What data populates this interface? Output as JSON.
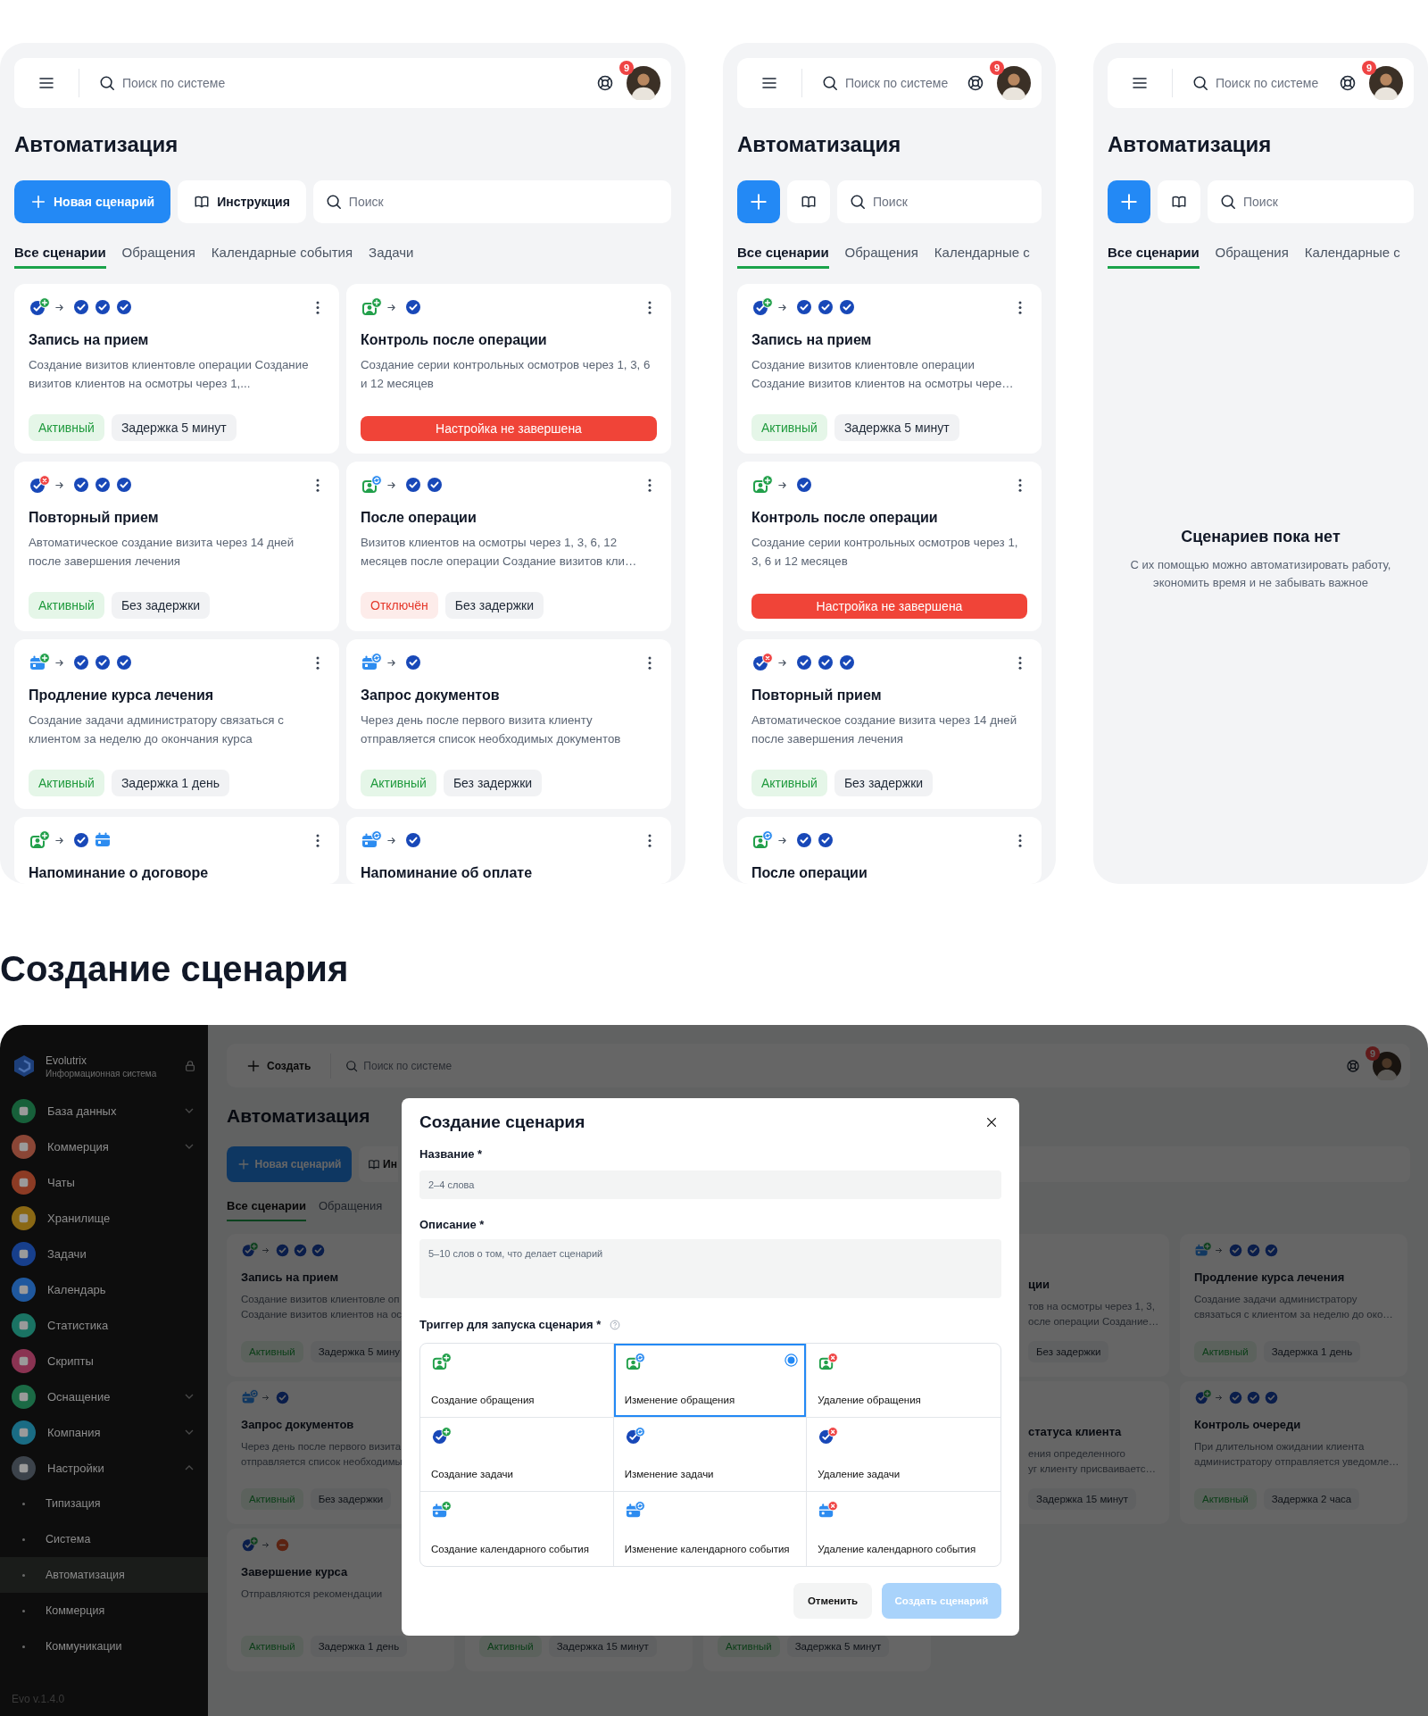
{
  "screens": [
    {
      "kind": "wide",
      "search_placeholder": "Поиск по системе",
      "notifications": "9",
      "title": "Автоматизация",
      "new_button": "Новая сценарий",
      "guide_button": "Инструкция",
      "filter_placeholder": "Поиск",
      "tabs": [
        {
          "label": "Все сценарии",
          "selected": true
        },
        {
          "label": "Обращения",
          "selected": false
        },
        {
          "label": "Календарные события",
          "selected": false
        },
        {
          "label": "Задачи",
          "selected": false
        }
      ],
      "cards": [
        {
          "trigger": {
            "kind": "task",
            "badge": {
              "kind": "add"
            }
          },
          "actions": [
            {
              "kind": "task"
            },
            {
              "kind": "task"
            },
            {
              "kind": "task"
            }
          ],
          "title": "Запись на прием",
          "description": "Создание визитов клиентовле операции Создание визитов клиентов на осмотры через 1,...",
          "status": {
            "label": "Активный",
            "kind": "active"
          },
          "delay": "Задержка 5 минут"
        },
        {
          "trigger": {
            "kind": "request",
            "badge": {
              "kind": "add"
            }
          },
          "actions": [
            {
              "kind": "task"
            }
          ],
          "title": "Контроль после операции",
          "description": "Создание серии контрольных осмотров через 1, 3, 6 и 12 месяцев",
          "alert": "Настройка не завершена"
        },
        {
          "trigger": {
            "kind": "task",
            "badge": {
              "kind": "remove"
            }
          },
          "actions": [
            {
              "kind": "task"
            },
            {
              "kind": "task"
            },
            {
              "kind": "task"
            }
          ],
          "title": "Повторный прием",
          "description": "Автоматическое создание визита через 14 дней после завершения лечения",
          "status": {
            "label": "Активный",
            "kind": "active"
          },
          "delay": "Без задержки"
        },
        {
          "trigger": {
            "kind": "request",
            "badge": {
              "kind": "edit"
            }
          },
          "actions": [
            {
              "kind": "task"
            },
            {
              "kind": "task"
            }
          ],
          "title": "После операции",
          "description": "Визитов клиентов на осмотры через 1, 3, 6, 12 месяцев после операции Создание визитов кли…",
          "status": {
            "label": "Отключён",
            "kind": "off"
          },
          "delay": "Без задержки"
        },
        {
          "trigger": {
            "kind": "event",
            "badge": {
              "kind": "add"
            }
          },
          "actions": [
            {
              "kind": "task"
            },
            {
              "kind": "task"
            },
            {
              "kind": "task"
            }
          ],
          "title": "Продление курса лечения",
          "description": "Создание задачи администратору связаться с клиентом за неделю до окончания курса",
          "status": {
            "label": "Активный",
            "kind": "active"
          },
          "delay": "Задержка 1 день"
        },
        {
          "trigger": {
            "kind": "event",
            "badge": {
              "kind": "edit"
            }
          },
          "actions": [
            {
              "kind": "task"
            }
          ],
          "title": "Запрос документов",
          "description": "Через день после первого визита клиенту отправляется список необходимых документов",
          "status": {
            "label": "Активный",
            "kind": "active"
          },
          "delay": "Без задержки"
        },
        {
          "trigger": {
            "kind": "request",
            "badge": {
              "kind": "add"
            }
          },
          "actions": [
            {
              "kind": "task"
            },
            {
              "kind": "event"
            }
          ],
          "title": "Напоминание о договоре"
        },
        {
          "trigger": {
            "kind": "event",
            "badge": {
              "kind": "edit"
            }
          },
          "actions": [
            {
              "kind": "task"
            }
          ],
          "title": "Напоминание об оплате"
        }
      ]
    },
    {
      "kind": "narrow",
      "search_placeholder": "Поиск по системе",
      "notifications": "9",
      "title": "Автоматизация",
      "filter_placeholder": "Поиск",
      "tabs": [
        {
          "label": "Все сценарии",
          "selected": true
        },
        {
          "label": "Обращения",
          "selected": false
        },
        {
          "label": "Календарные с",
          "selected": false
        }
      ],
      "cards": [
        {
          "trigger": {
            "kind": "task",
            "badge": {
              "kind": "add"
            }
          },
          "actions": [
            {
              "kind": "task"
            },
            {
              "kind": "task"
            },
            {
              "kind": "task"
            }
          ],
          "title": "Запись на прием",
          "description": "Создание визитов клиентовле операции Создание визитов клиентов на осмотры чере…",
          "status": {
            "label": "Активный",
            "kind": "active"
          },
          "delay": "Задержка 5 минут"
        },
        {
          "trigger": {
            "kind": "request",
            "badge": {
              "kind": "add"
            }
          },
          "actions": [
            {
              "kind": "task"
            }
          ],
          "title": "Контроль после операции",
          "description": "Создание серии контрольных осмотров через 1, 3, 6 и 12 месяцев",
          "alert": "Настройка не завершена"
        },
        {
          "trigger": {
            "kind": "task",
            "badge": {
              "kind": "remove"
            }
          },
          "actions": [
            {
              "kind": "task"
            },
            {
              "kind": "task"
            },
            {
              "kind": "task"
            }
          ],
          "title": "Повторный прием",
          "description": "Автоматическое создание визита через 14 дней после завершения лечения",
          "status": {
            "label": "Активный",
            "kind": "active"
          },
          "delay": "Без задержки"
        },
        {
          "trigger": {
            "kind": "request",
            "badge": {
              "kind": "edit"
            }
          },
          "actions": [
            {
              "kind": "task"
            },
            {
              "kind": "task"
            }
          ],
          "title": "После операции"
        }
      ]
    },
    {
      "kind": "empty",
      "search_placeholder": "Поиск по системе",
      "notifications": "9",
      "title": "Автоматизация",
      "filter_placeholder": "Поиск",
      "tabs": [
        {
          "label": "Все сценарии",
          "selected": true
        },
        {
          "label": "Обращения",
          "selected": false
        },
        {
          "label": "Календарные с",
          "selected": false
        }
      ],
      "empty_title": "Сценариев пока нет",
      "empty_text": "С их помощью можно автоматизировать работу, экономить время и не забывать важное"
    }
  ],
  "section_title": "Создание сценария",
  "app": {
    "brand": "Evolutrix",
    "subtitle": "Информационная система",
    "version": "Evo v.1.4.0",
    "nav": [
      {
        "label": "База данных",
        "color": "#17603a",
        "expanded": false
      },
      {
        "label": "Коммерция",
        "color": "#8a4636",
        "expanded": false
      },
      {
        "label": "Чаты",
        "color": "#8c3b24"
      },
      {
        "label": "Хранилище",
        "color": "#8a6814"
      },
      {
        "label": "Задачи",
        "color": "#173f8c"
      },
      {
        "label": "Календарь",
        "color": "#1f589e"
      },
      {
        "label": "Статистика",
        "color": "#1a7363"
      },
      {
        "label": "Скрипты",
        "color": "#8a3352"
      },
      {
        "label": "Оснащение",
        "color": "#1b6a45",
        "expanded": false
      },
      {
        "label": "Компания",
        "color": "#1a6c84",
        "expanded": false
      },
      {
        "label": "Настройки",
        "color": "#3c434b",
        "expanded": true,
        "children": [
          {
            "label": "Типизация",
            "selected": false
          },
          {
            "label": "Система",
            "selected": false
          },
          {
            "label": "Автоматизация",
            "selected": true
          },
          {
            "label": "Коммерция",
            "selected": false
          },
          {
            "label": "Коммуникации",
            "selected": false
          }
        ]
      }
    ],
    "create_button": "Создать",
    "search_placeholder": "Поиск по системе",
    "notifications": "9",
    "title": "Автоматизация",
    "new_button": "Новая сценарий",
    "guide_button": "Ин",
    "tabs": [
      {
        "label": "Все сценарии",
        "selected": true
      },
      {
        "label": "Обращения",
        "selected": false
      }
    ],
    "cards": [
      {
        "kind": "full",
        "trigger": {
          "kind": "task",
          "badge": {
            "kind": "add"
          }
        },
        "actions": [
          {
            "kind": "task"
          },
          {
            "kind": "task"
          },
          {
            "kind": "task"
          }
        ],
        "title": "Запись на прием",
        "description_lines": [
          "Создание визитов клиентовле оп",
          "Создание визитов клиентов на ос"
        ],
        "status": {
          "label": "Активный",
          "kind": "active"
        },
        "delay": "Задержка 5 мину"
      },
      {
        "kind": "covered"
      },
      {
        "kind": "covered"
      },
      {
        "kind": "fragment",
        "title": "ции",
        "description_lines": [
          "тов на осмотры через 1, 3,",
          "осле операции Создание…"
        ],
        "delay": "Без задержки"
      },
      {
        "kind": "full",
        "trigger": {
          "kind": "event",
          "badge": {
            "kind": "add"
          }
        },
        "actions": [
          {
            "kind": "task"
          },
          {
            "kind": "task"
          },
          {
            "kind": "task"
          }
        ],
        "title": "Продление курса лечения",
        "description_lines": [
          "Создание задачи администратору",
          "связаться с клиентом за неделю до око…"
        ],
        "status": {
          "label": "Активный",
          "kind": "active"
        },
        "delay": "Задержка 1 день"
      },
      {
        "kind": "full",
        "trigger": {
          "kind": "event",
          "badge": {
            "kind": "edit"
          }
        },
        "actions": [
          {
            "kind": "task"
          }
        ],
        "title": "Запрос документов",
        "description_lines": [
          "Через день после первого визита",
          "отправляется список необходимы"
        ],
        "status": {
          "label": "Активный",
          "kind": "active"
        },
        "delay": "Без задержки"
      },
      {
        "kind": "covered"
      },
      {
        "kind": "covered"
      },
      {
        "kind": "fragment",
        "title": "статуса клиента",
        "description_lines": [
          "ения определенного",
          "уг клиенту присваиваетс…"
        ],
        "delay": "Задержка 15 минут"
      },
      {
        "kind": "full",
        "trigger": {
          "kind": "task",
          "badge": {
            "kind": "add"
          }
        },
        "actions": [
          {
            "kind": "task"
          },
          {
            "kind": "task"
          },
          {
            "kind": "task"
          }
        ],
        "title": "Контроль очереди",
        "description_lines": [
          "При длительном ожидании клиента",
          "администратору отправляется уведомле…"
        ],
        "status": {
          "label": "Активный",
          "kind": "active"
        },
        "delay": "Задержка 2 часа"
      },
      {
        "kind": "full",
        "trigger": {
          "kind": "task",
          "badge": {
            "kind": "add"
          }
        },
        "actions": [
          {
            "kind": "message"
          }
        ],
        "title": "Завершение курса",
        "description_lines": [
          "Отправляются рекомендации"
        ],
        "status": {
          "label": "Активный",
          "kind": "active"
        },
        "delay": "Задержка 1 день"
      },
      {
        "kind": "tags",
        "status": {
          "label": "Активный",
          "kind": "active"
        },
        "delay": "Задержка 15 минут"
      },
      {
        "kind": "tags",
        "status": {
          "label": "Активный",
          "kind": "active"
        },
        "delay": "Задержка 5 минут"
      }
    ]
  },
  "dialog": {
    "title": "Создание сценария",
    "name_label": "Название *",
    "name_placeholder": "2–4 слова",
    "description_label": "Описание *",
    "description_placeholder": "5–10 слов о том, что делает сценарий",
    "trigger_label": "Триггер для запуска сценария *",
    "options": [
      {
        "label": "Создание обращения",
        "kind": "request",
        "badge": {
          "kind": "add"
        },
        "selected": false
      },
      {
        "label": "Изменение обращения",
        "kind": "request",
        "badge": {
          "kind": "edit"
        },
        "selected": true
      },
      {
        "label": "Удаление обращения",
        "kind": "request",
        "badge": {
          "kind": "remove"
        },
        "selected": false
      },
      {
        "label": "Создание задачи",
        "kind": "task",
        "badge": {
          "kind": "add"
        },
        "selected": false
      },
      {
        "label": "Изменение задачи",
        "kind": "task",
        "badge": {
          "kind": "edit"
        },
        "selected": false
      },
      {
        "label": "Удаление задачи",
        "kind": "task",
        "badge": {
          "kind": "remove"
        },
        "selected": false
      },
      {
        "label": "Создание календарного события",
        "kind": "event",
        "badge": {
          "kind": "add"
        },
        "selected": false
      },
      {
        "label": "Изменение календарного события",
        "kind": "event",
        "badge": {
          "kind": "edit"
        },
        "selected": false
      },
      {
        "label": "Удаление календарного события",
        "kind": "event",
        "badge": {
          "kind": "remove"
        },
        "selected": false
      }
    ],
    "cancel_button": "Отменить",
    "submit_button": {
      "label": "Создать сценарий",
      "disabled": true
    }
  }
}
